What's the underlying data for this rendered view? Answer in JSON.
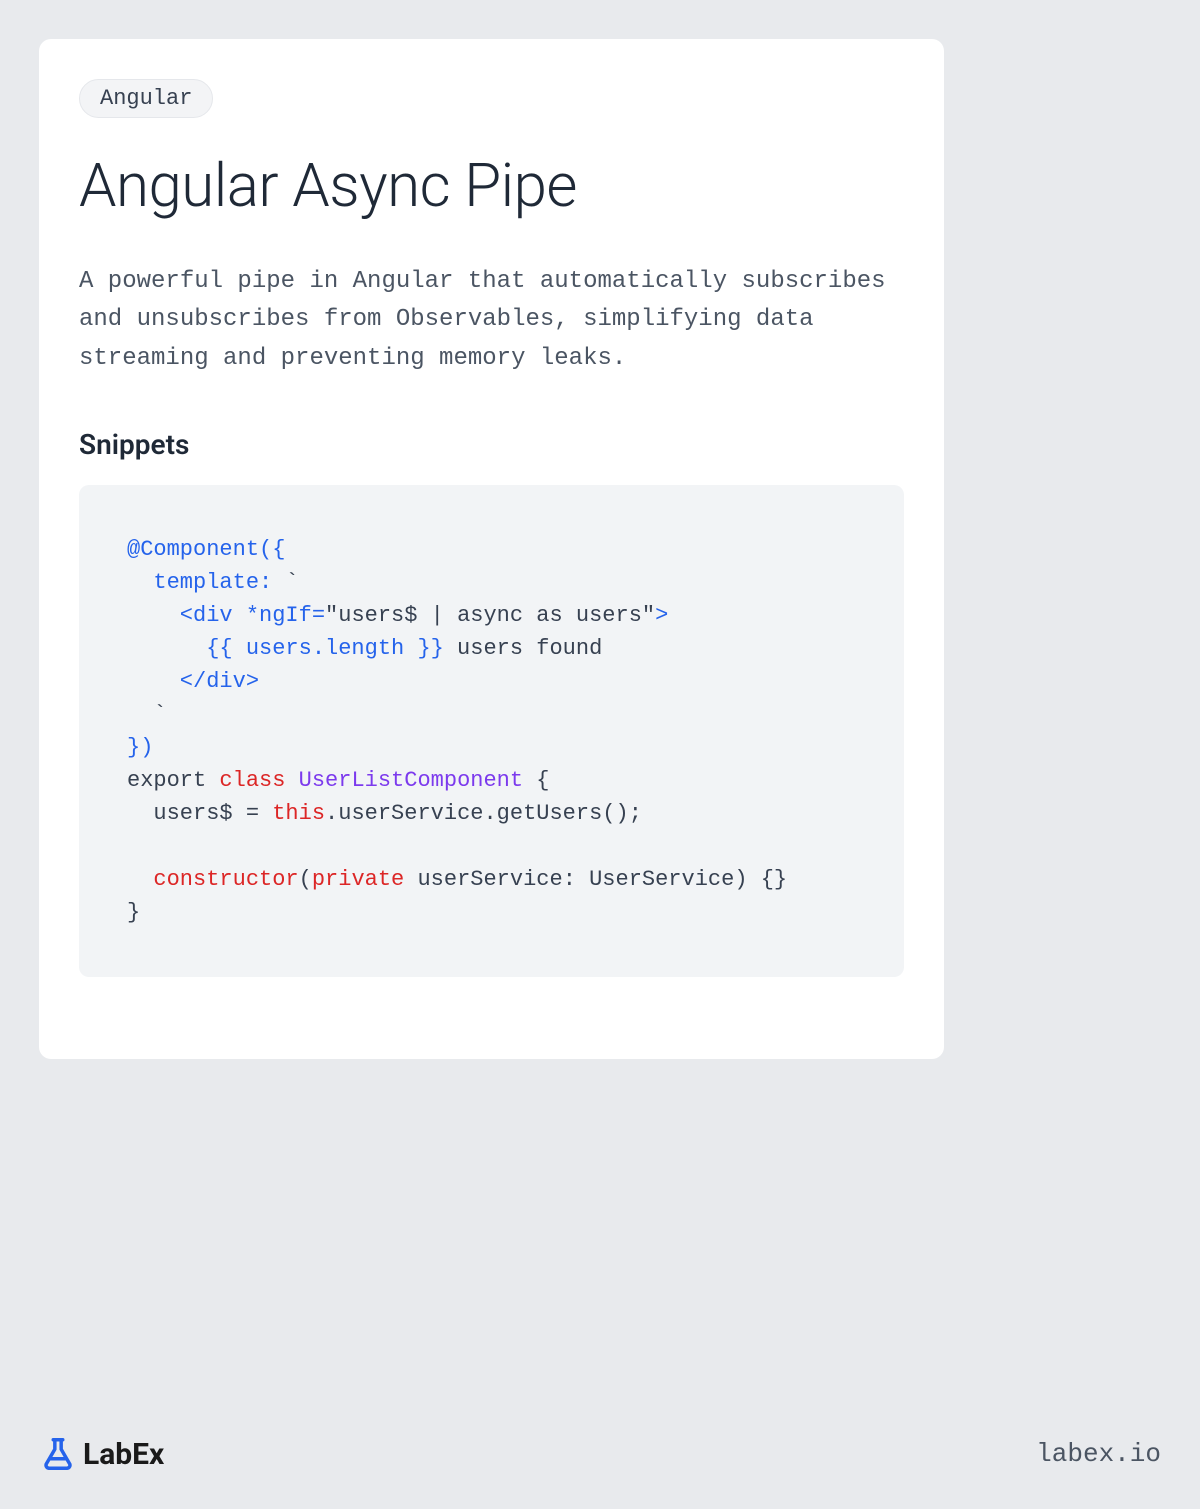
{
  "tag": "Angular",
  "title": "Angular Async Pipe",
  "description": "A powerful pipe in Angular that automatically subscribes and unsubscribes from Observables, simplifying data streaming and preventing memory leaks.",
  "snippets_heading": "Snippets",
  "code": {
    "l1a": "@Component",
    "l1b": "({",
    "l2a": "  template: ",
    "l2b": "`",
    "l3a": "    <div *ngIf=",
    "l3b": "\"users$ | async as users\"",
    "l3c": ">",
    "l4a": "      {{ users.length }}",
    "l4b": " users found",
    "l5": "    </div>",
    "l6": "  `",
    "l7": "})",
    "l8a": "export ",
    "l8b": "class",
    "l8c": " ",
    "l8d": "UserListComponent",
    "l8e": " {",
    "l9a": "  users$ = ",
    "l9b": "this",
    "l9c": ".userService.getUsers();",
    "l10": "",
    "l11a": "  ",
    "l11b": "constructor",
    "l11c": "(",
    "l11d": "private",
    "l11e": " userService: UserService) {}",
    "l12": "}"
  },
  "footer": {
    "brand": "LabEx",
    "domain": "labex.io"
  }
}
